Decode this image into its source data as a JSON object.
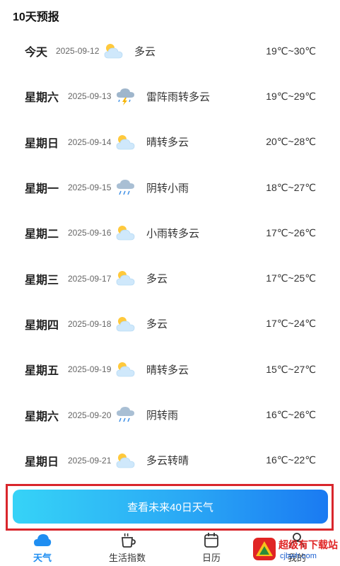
{
  "section": {
    "title": "10天预报"
  },
  "days": [
    {
      "day": "今天",
      "date": "2025-09-12",
      "icon": "partly-cloudy",
      "desc": "多云",
      "temp": "19℃~30℃"
    },
    {
      "day": "星期六",
      "date": "2025-09-13",
      "icon": "thunderstorm",
      "desc": "雷阵雨转多云",
      "temp": "19℃~29℃"
    },
    {
      "day": "星期日",
      "date": "2025-09-14",
      "icon": "partly-cloudy",
      "desc": "晴转多云",
      "temp": "20℃~28℃"
    },
    {
      "day": "星期一",
      "date": "2025-09-15",
      "icon": "rain",
      "desc": "阴转小雨",
      "temp": "18℃~27℃"
    },
    {
      "day": "星期二",
      "date": "2025-09-16",
      "icon": "partly-cloudy",
      "desc": "小雨转多云",
      "temp": "17℃~26℃"
    },
    {
      "day": "星期三",
      "date": "2025-09-17",
      "icon": "partly-cloudy",
      "desc": "多云",
      "temp": "17℃~25℃"
    },
    {
      "day": "星期四",
      "date": "2025-09-18",
      "icon": "partly-cloudy",
      "desc": "多云",
      "temp": "17℃~24℃"
    },
    {
      "day": "星期五",
      "date": "2025-09-19",
      "icon": "partly-cloudy",
      "desc": "晴转多云",
      "temp": "15℃~27℃"
    },
    {
      "day": "星期六",
      "date": "2025-09-20",
      "icon": "rain",
      "desc": "阴转雨",
      "temp": "16℃~26℃"
    },
    {
      "day": "星期日",
      "date": "2025-09-21",
      "icon": "partly-cloudy",
      "desc": "多云转晴",
      "temp": "16℃~22℃"
    }
  ],
  "forecast_button": {
    "label": "查看未来40日天气"
  },
  "tabbar": {
    "tabs": [
      {
        "label": "天气",
        "icon": "cloud-icon",
        "active": true
      },
      {
        "label": "生活指数",
        "icon": "cup-icon",
        "active": false
      },
      {
        "label": "日历",
        "icon": "calendar-icon",
        "active": false
      },
      {
        "label": "我的",
        "icon": "user-icon",
        "active": false
      }
    ]
  },
  "watermark": {
    "text": "超级有下载站",
    "sub": "cjbwh.com"
  },
  "colors": {
    "accent": "#1f8ef1",
    "button_start": "#36d3f7",
    "button_end": "#1a7af2",
    "highlight_frame": "#d9262c"
  }
}
